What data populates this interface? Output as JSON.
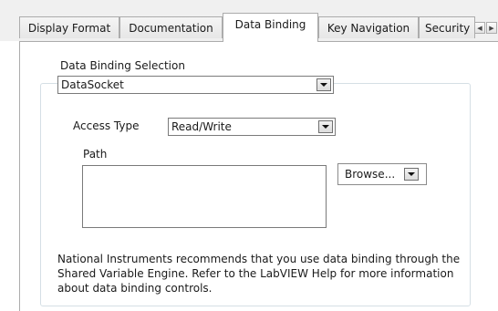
{
  "tabs": [
    {
      "label": "Display Format",
      "active": false
    },
    {
      "label": "Documentation",
      "active": false
    },
    {
      "label": "Data Binding",
      "active": true
    },
    {
      "label": "Key Navigation",
      "active": false
    },
    {
      "label": "Security",
      "active": false
    }
  ],
  "tab_scroll": {
    "left_icon": "chevron-left-icon",
    "right_icon": "chevron-right-icon"
  },
  "binding": {
    "selection_label": "Data Binding Selection",
    "selection_value": "DataSocket",
    "access_label": "Access Type",
    "access_value": "Read/Write",
    "path_label": "Path",
    "path_value": "",
    "browse_label": "Browse..."
  },
  "note_lines": [
    "National Instruments recommends that you use data binding through the",
    "Shared Variable Engine.  Refer to the LabVIEW Help for more information",
    "about data binding controls."
  ],
  "colors": {
    "tab_border": "#acacac",
    "group_border": "#d5dfe5",
    "background": "#f0f0f0"
  }
}
